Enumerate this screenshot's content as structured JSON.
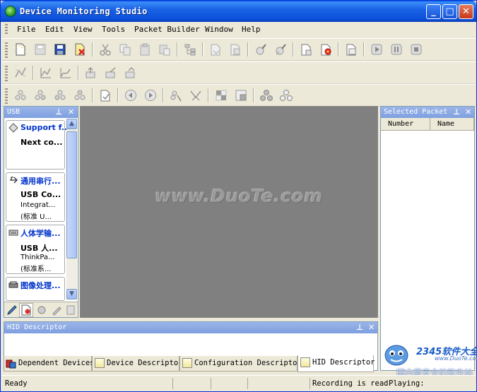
{
  "window": {
    "title": "Device Monitoring Studio"
  },
  "menu": [
    "File",
    "Edit",
    "View",
    "Tools",
    "Packet Builder",
    "Window",
    "Help"
  ],
  "left_pane": {
    "title": "USB",
    "devices": [
      {
        "title": "Support f...",
        "lines": [
          "Next co..."
        ]
      },
      {
        "title": "通用串行...",
        "lines": [
          "USB Co...",
          "Integrat...",
          "(标准 U..."
        ]
      },
      {
        "title": "人体学输...",
        "lines": [
          "USB 人...",
          "ThinkPa...",
          "(标准系..."
        ]
      },
      {
        "title": "图像处理...",
        "lines": []
      }
    ]
  },
  "center": {
    "watermark": "www.DuoTe.com"
  },
  "right_pane": {
    "title": "Selected Packet",
    "columns": [
      "Number",
      "Name"
    ]
  },
  "bottom_pane": {
    "title": "HID Descriptor",
    "tabs": [
      "Dependent Devices",
      "Device Descriptor",
      "Configuration Descriptor",
      "HID Descriptor"
    ],
    "active_tab": "HID Descriptor"
  },
  "status": {
    "left": "Ready",
    "recording": "Recording is ready",
    "playing": "Playing:"
  },
  "logo": {
    "brand": "2345软件大全",
    "url": "www.DuoTe.com",
    "sub": "国内最安全的软件站"
  }
}
